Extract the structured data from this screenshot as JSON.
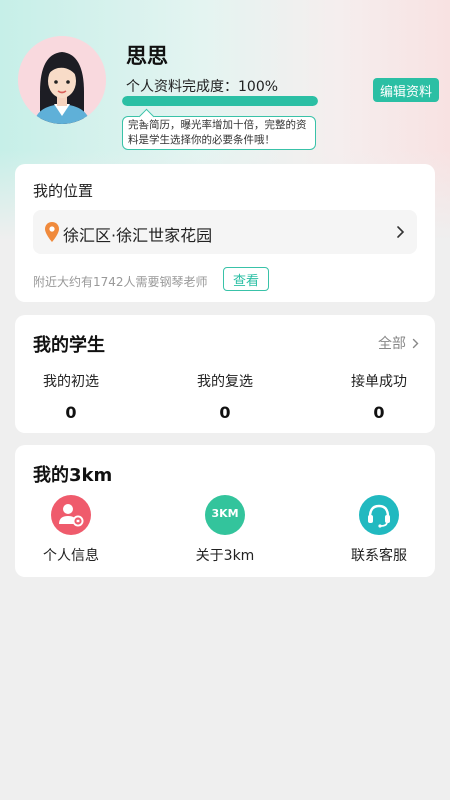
{
  "profile": {
    "name": "思思",
    "completion_label": "个人资料完成度：",
    "completion_value": "100%",
    "completion_fraction": 1.0,
    "tip": "完善简历，曝光率增加十倍，完整的资料是学生选择你的必要条件哦！",
    "edit_button": "编辑资料"
  },
  "location": {
    "title": "我的位置",
    "address": "徐汇区·徐汇世家花园",
    "nearby_text": "附近大约有1742人需要钢琴老师",
    "view_button": "查看"
  },
  "students": {
    "title": "我的学生",
    "all_link": "全部",
    "stats": [
      {
        "label": "我的初选",
        "value": "0"
      },
      {
        "label": "我的复选",
        "value": "0"
      },
      {
        "label": "接单成功",
        "value": "0"
      }
    ]
  },
  "my3km": {
    "title": "我的3km",
    "features": [
      {
        "label": "个人信息",
        "icon": "person-info-icon"
      },
      {
        "label": "关于3km",
        "icon": "3km-logo-icon",
        "icon_text": "3KM"
      },
      {
        "label": "联系客服",
        "icon": "headset-icon"
      }
    ]
  },
  "colors": {
    "accent": "#2bbfa4",
    "pin": "#f08a3c",
    "person_icon": "#ef5b6c",
    "logo_icon": "#33c49c",
    "headset_icon": "#21b9c0"
  }
}
